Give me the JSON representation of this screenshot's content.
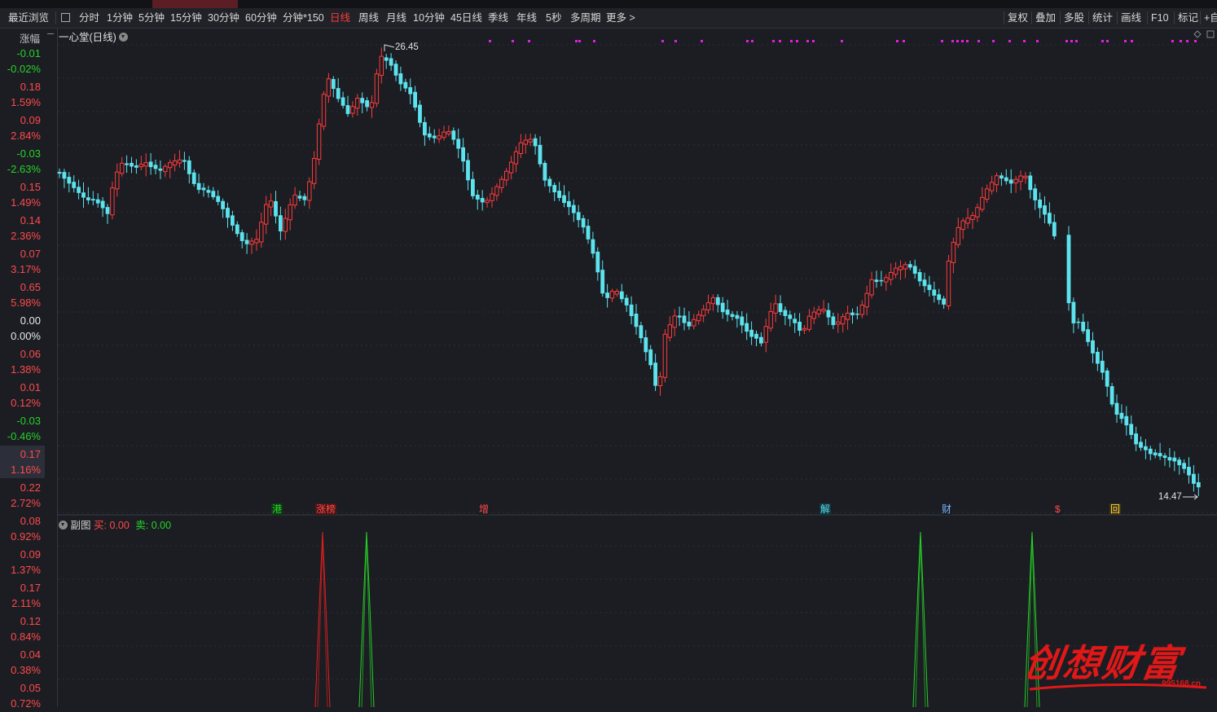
{
  "toolbar": {
    "recent": "最近浏览",
    "periods": [
      "分时",
      "1分钟",
      "5分钟",
      "15分钟",
      "30分钟",
      "60分钟",
      "分钟*150",
      "日线",
      "周线",
      "月线",
      "10分钟",
      "45日线",
      "季线",
      "年线",
      "5秒",
      "多周期",
      "更多 >"
    ],
    "active_period": "日线",
    "right_items": [
      "复权",
      "叠加",
      "多股",
      "统计",
      "画线",
      "F10",
      "标记",
      "+自"
    ]
  },
  "sidebar": {
    "header": "涨幅",
    "rows": [
      {
        "top": "-0.01",
        "bottom": "-0.02%",
        "dir": "dn"
      },
      {
        "top": "0.18",
        "bottom": "1.59%",
        "dir": "up"
      },
      {
        "top": "0.09",
        "bottom": "2.84%",
        "dir": "up"
      },
      {
        "top": "-0.03",
        "bottom": "-2.63%",
        "dir": "dn"
      },
      {
        "top": "0.15",
        "bottom": "1.49%",
        "dir": "up"
      },
      {
        "top": "0.14",
        "bottom": "2.36%",
        "dir": "up"
      },
      {
        "top": "0.07",
        "bottom": "3.17%",
        "dir": "up"
      },
      {
        "top": "0.65",
        "bottom": "5.98%",
        "dir": "up"
      },
      {
        "top": "0.00",
        "bottom": "0.00%",
        "dir": "wh"
      },
      {
        "top": "0.06",
        "bottom": "1.38%",
        "dir": "up"
      },
      {
        "top": "0.01",
        "bottom": "0.12%",
        "dir": "up"
      },
      {
        "top": "-0.03",
        "bottom": "-0.46%",
        "dir": "dn"
      },
      {
        "top": "0.17",
        "bottom": "1.16%",
        "dir": "up",
        "highlight": true
      },
      {
        "top": "0.22",
        "bottom": "2.72%",
        "dir": "up"
      },
      {
        "top": "0.08",
        "bottom": "0.92%",
        "dir": "up"
      },
      {
        "top": "0.09",
        "bottom": "1.37%",
        "dir": "up"
      },
      {
        "top": "0.17",
        "bottom": "2.11%",
        "dir": "up"
      },
      {
        "top": "0.12",
        "bottom": "0.84%",
        "dir": "up"
      },
      {
        "top": "0.04",
        "bottom": "0.38%",
        "dir": "up"
      },
      {
        "top": "0.05",
        "bottom": "0.72%",
        "dir": "up"
      }
    ]
  },
  "main_panel": {
    "title": "一心堂(日线)",
    "high_label": "26.45",
    "low_label": "14.47",
    "price_high": 26.45,
    "price_low": 14.47
  },
  "event_tags": [
    {
      "text": "港",
      "color": "#2ad82a",
      "bg": "#0f3a12"
    },
    {
      "text": "涨榜",
      "color": "#ff4a4a",
      "bg": "#4a1515"
    },
    {
      "text": "增",
      "color": "#ff4a4a",
      "bg": "#1b1d23"
    },
    {
      "text": "解",
      "color": "#5fd7e6",
      "bg": "#0f3840"
    },
    {
      "text": "财",
      "color": "#7ab6ff",
      "bg": "#1b1d23"
    },
    {
      "text": "$",
      "color": "#ff4a4a",
      "bg": "#1b1d23"
    },
    {
      "text": "回",
      "color": "#ffd24a",
      "bg": "#3d3413"
    }
  ],
  "sub_panel": {
    "title": "副图",
    "buy_label": "买:",
    "buy_value": "0.00",
    "sell_label": "卖:",
    "sell_value": "0.00"
  },
  "colors": {
    "up": "#ff3b3b",
    "down": "#5ce3ee",
    "green": "#27d227",
    "magenta": "#e020e0",
    "grid": "#2c2f36"
  },
  "watermark": {
    "text": "创想财富",
    "url": "995168.cn"
  }
}
